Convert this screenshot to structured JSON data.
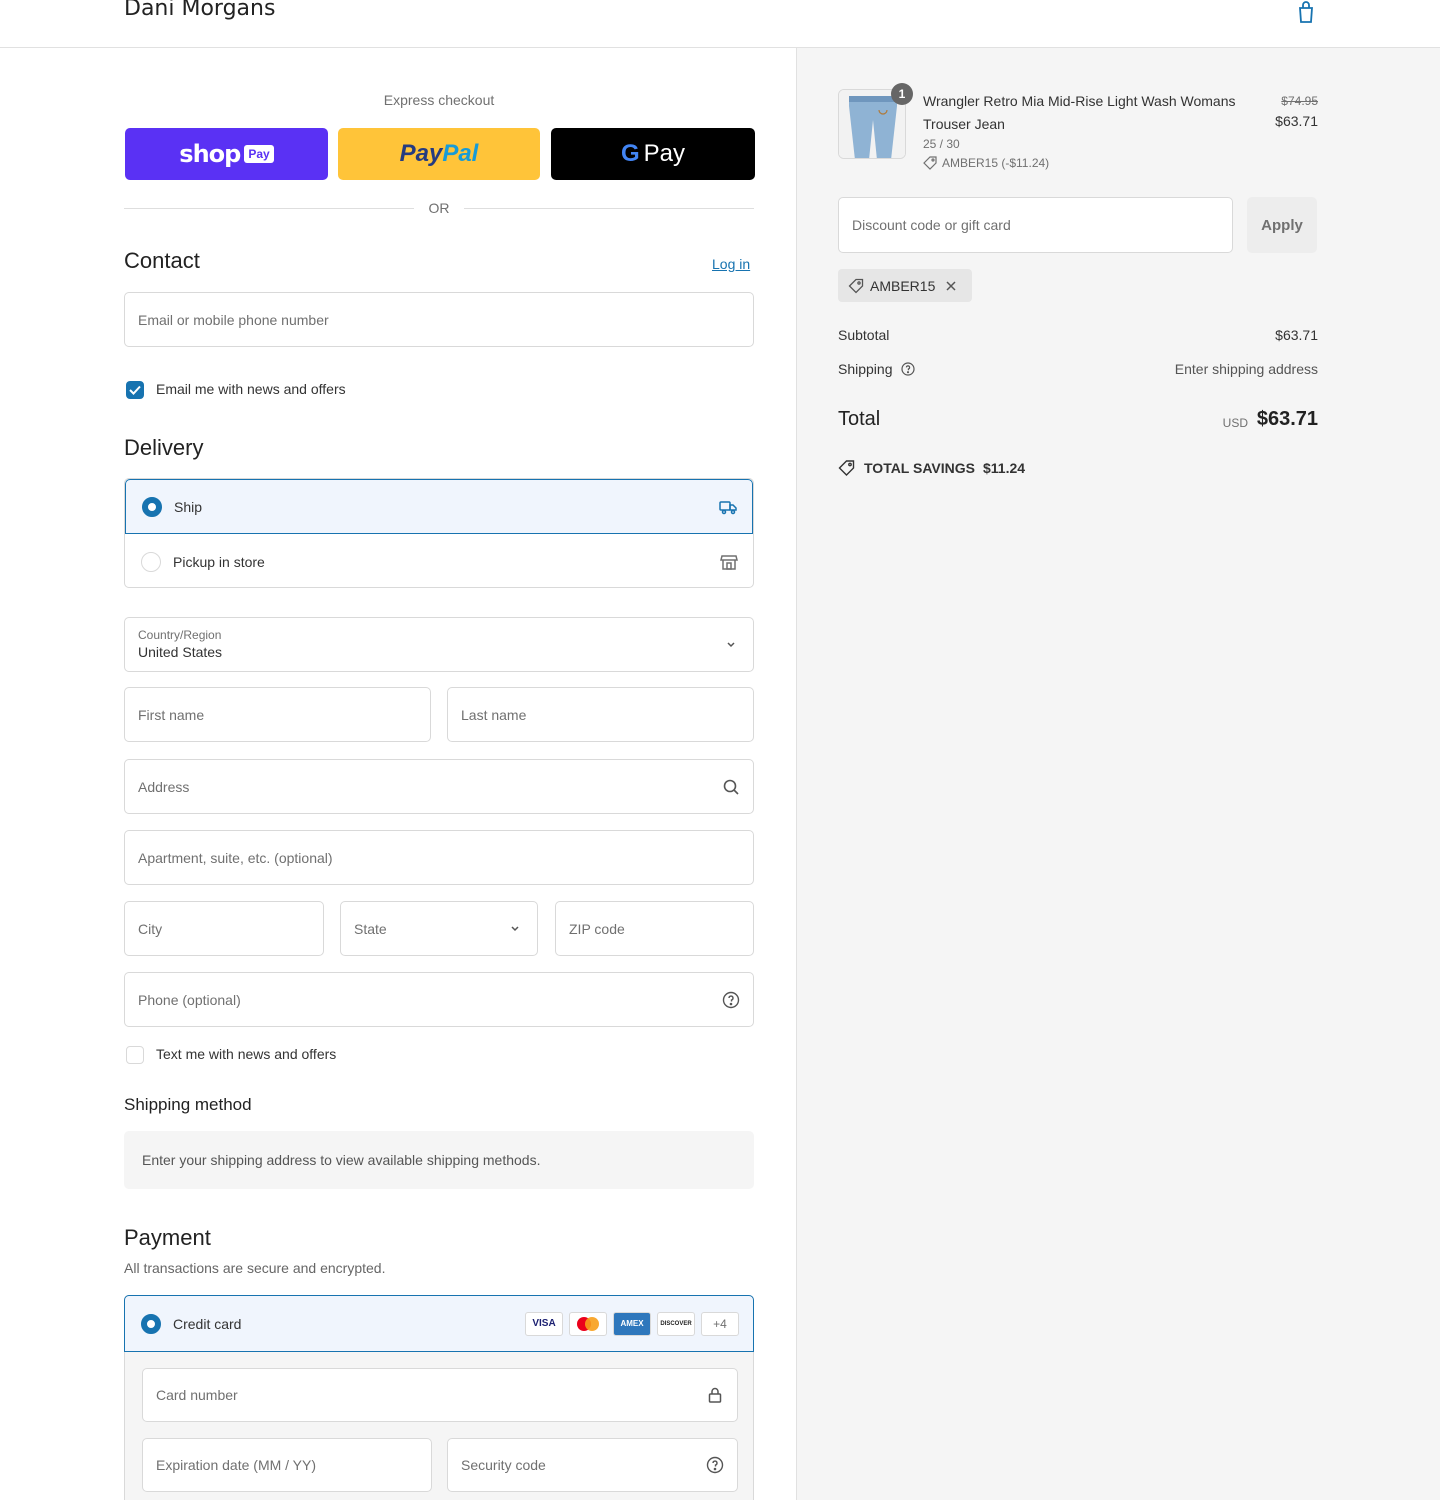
{
  "header": {
    "store_name": "Dani Morgans",
    "cart_icon": "shopping-bag-icon"
  },
  "express": {
    "label": "Express checkout",
    "shop_pay": {
      "word": "shop",
      "badge": "Pay"
    },
    "paypal": {
      "part1": "Pay",
      "part2": "Pal"
    },
    "gpay": {
      "g": "G",
      "word": "Pay"
    },
    "or_text": "OR"
  },
  "contact": {
    "title": "Contact",
    "login": "Log in",
    "email_placeholder": "Email or mobile phone number",
    "newsletter_label": "Email me with news and offers",
    "newsletter_checked": true
  },
  "delivery": {
    "title": "Delivery",
    "options": [
      {
        "label": "Ship",
        "selected": true,
        "icon": "truck-icon"
      },
      {
        "label": "Pickup in store",
        "selected": false,
        "icon": "store-icon"
      }
    ],
    "country_label": "Country/Region",
    "country_value": "United States",
    "first_name": "First name",
    "last_name": "Last name",
    "address": "Address",
    "apartment": "Apartment, suite, etc. (optional)",
    "city": "City",
    "state": "State",
    "zip": "ZIP code",
    "phone": "Phone (optional)",
    "sms_label": "Text me with news and offers",
    "sms_checked": false
  },
  "shipping_method": {
    "title": "Shipping method",
    "info": "Enter your shipping address to view available shipping methods."
  },
  "payment": {
    "title": "Payment",
    "subtitle": "All transactions are secure and encrypted.",
    "method_label": "Credit card",
    "card_logos": [
      "VISA",
      "MC",
      "AMEX",
      "DISCOVER",
      "+4"
    ],
    "card_number": "Card number",
    "expiration": "Expiration date (MM / YY)",
    "security_code": "Security code"
  },
  "summary": {
    "product": {
      "quantity": "1",
      "name": "Wrangler Retro Mia Mid-Rise Light Wash Womans Trouser Jean",
      "variant": "25 / 30",
      "discount": "AMBER15 (-$11.24)",
      "price_old": "$74.95",
      "price_new": "$63.71"
    },
    "discount_placeholder": "Discount code or gift card",
    "apply_label": "Apply",
    "applied_code": "AMBER15",
    "subtotal_label": "Subtotal",
    "subtotal_value": "$63.71",
    "shipping_label": "Shipping",
    "shipping_value": "Enter shipping address",
    "total_label": "Total",
    "total_currency": "USD",
    "total_value": "$63.71",
    "savings_label": "TOTAL SAVINGS",
    "savings_value": "$11.24"
  }
}
